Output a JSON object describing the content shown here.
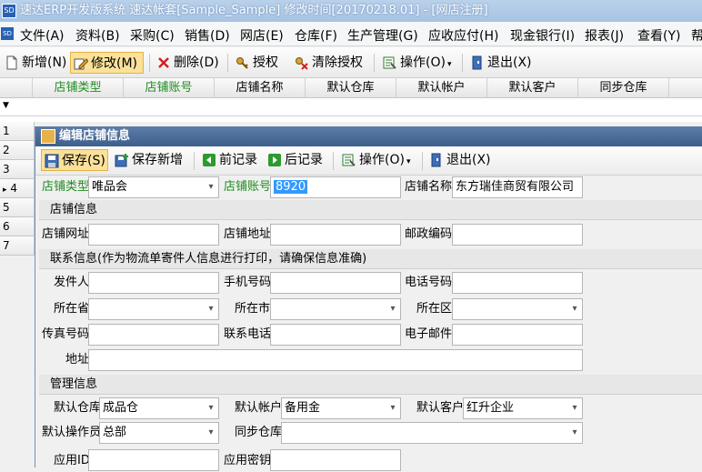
{
  "titlebar": {
    "logo": "SD",
    "title": "速达ERP开发版系统  速达帐套[Sample_Sample] 修改时间[20170218.01] - [网店注册]"
  },
  "menu": [
    "文件(A)",
    "资料(B)",
    "采购(C)",
    "销售(D)",
    "网店(E)",
    "仓库(F)",
    "生产管理(G)",
    "应收应付(H)",
    "现金银行(I)",
    "报表(J)",
    "查看(Y)",
    "帮"
  ],
  "toolbar": {
    "new": "新增(N)",
    "edit": "修改(M)",
    "delete": "删除(D)",
    "authorize": "授权",
    "clear_auth": "清除授权",
    "operate": "操作(O)",
    "exit": "退出(X)"
  },
  "grid": {
    "columns": [
      "店铺类型",
      "店铺账号",
      "店铺名称",
      "默认仓库",
      "默认帐户",
      "默认客户",
      "同步仓库"
    ],
    "filter_icon": "▼",
    "rows": [
      "1",
      "2",
      "3",
      "4",
      "5",
      "6",
      "7"
    ],
    "current_marker": "▸"
  },
  "dialog": {
    "title": "编辑店铺信息",
    "toolbar": {
      "save": "保存(S)",
      "save_new": "保存新增",
      "prev": "前记录",
      "next": "后记录",
      "operate": "操作(O)",
      "exit": "退出(X)"
    },
    "fields": {
      "shop_type_label": "店铺类型",
      "shop_type_value": "唯品会",
      "shop_account_label": "店铺账号",
      "shop_account_value": "8920",
      "shop_name_label": "店铺名称",
      "shop_name_value": "东方瑞佳商贸有限公司"
    },
    "sections": {
      "shop_info": "店铺信息",
      "contact_info": "联系信息(作为物流单寄件人信息进行打印，请确保信息准确)",
      "manage_info": "管理信息"
    },
    "shop_info": {
      "url": "店铺网址",
      "address": "店铺地址",
      "zip": "邮政编码"
    },
    "contact": {
      "sender": "发件人",
      "mobile": "手机号码",
      "phone": "电话号码",
      "province": "所在省",
      "city": "所在市",
      "district": "所在区",
      "fax": "传真号码",
      "contact_phone": "联系电话",
      "email": "电子邮件",
      "address": "地址"
    },
    "manage": {
      "warehouse_label": "默认仓库",
      "warehouse_value": "成品仓",
      "account_label": "默认帐户",
      "account_value": "备用金",
      "customer_label": "默认客户",
      "customer_value": "红升企业",
      "operator_label": "默认操作员",
      "operator_value": "总部",
      "sync_label": "同步仓库",
      "app_id_label": "应用ID",
      "app_secret_label": "应用密钥"
    }
  }
}
